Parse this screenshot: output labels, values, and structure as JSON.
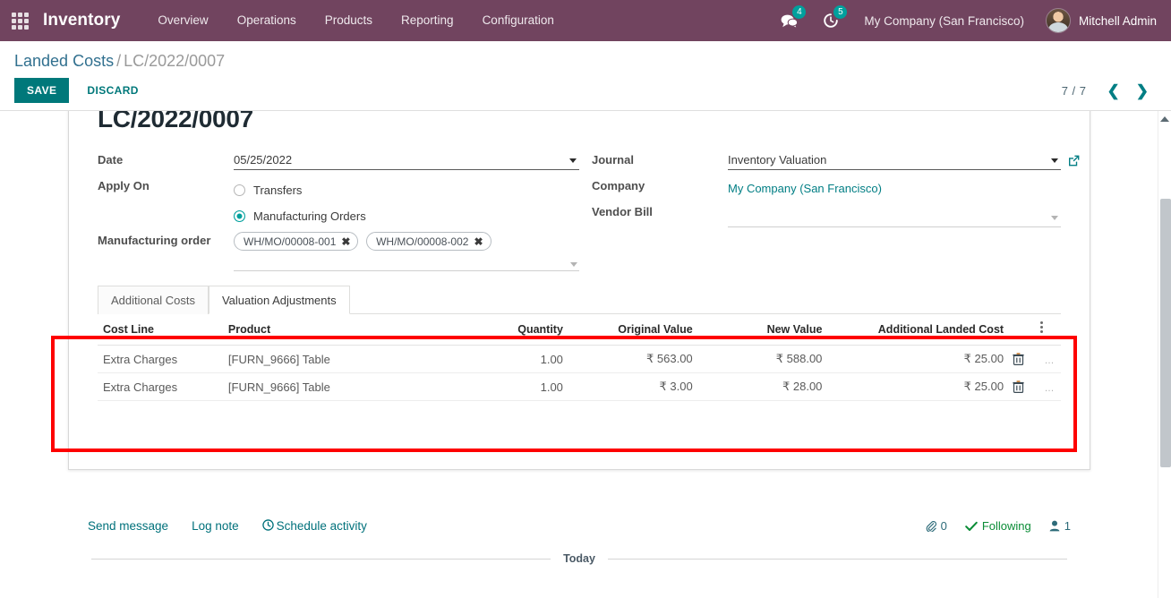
{
  "navbar": {
    "apps_icon": "apps-grid-icon",
    "brand": "Inventory",
    "menus": [
      "Overview",
      "Operations",
      "Products",
      "Reporting",
      "Configuration"
    ],
    "messages_icon": "messages-icon",
    "messages_count": "4",
    "activities_icon": "activities-clock-icon",
    "activities_count": "5",
    "company": "My Company (San Francisco)",
    "user": "Mitchell Admin"
  },
  "control_panel": {
    "breadcrumb_root": "Landed Costs",
    "breadcrumb_sep": "/",
    "breadcrumb_current": "LC/2022/0007",
    "save_label": "SAVE",
    "discard_label": "DISCARD",
    "pager_count": "7 / 7",
    "prev_icon": "chevron-left-icon",
    "next_icon": "chevron-right-icon"
  },
  "form": {
    "record_title": "LC/2022/0007",
    "date_label": "Date",
    "date_value": "05/25/2022",
    "apply_on_label": "Apply On",
    "apply_on_options": [
      {
        "label": "Transfers",
        "selected": false
      },
      {
        "label": "Manufacturing Orders",
        "selected": true
      }
    ],
    "mo_label": "Manufacturing order",
    "mo_tags": [
      "WH/MO/00008-001",
      "WH/MO/00008-002"
    ],
    "journal_label": "Journal",
    "journal_value": "Inventory Valuation",
    "journal_external_icon": "external-link-icon",
    "company_label": "Company",
    "company_value": "My Company (San Francisco)",
    "vendor_bill_label": "Vendor Bill",
    "vendor_bill_value": "",
    "vendor_bill_placeholder": ""
  },
  "notebook": {
    "tabs": [
      {
        "label": "Additional Costs",
        "active": false
      },
      {
        "label": "Valuation Adjustments",
        "active": true
      }
    ]
  },
  "table": {
    "columns": [
      "Cost Line",
      "Product",
      "Quantity",
      "Original Value",
      "New Value",
      "Additional Landed Cost"
    ],
    "optional_columns_icon": "vertical-dots-icon",
    "rows": [
      {
        "cost_line": "Extra Charges",
        "product": "[FURN_9666] Table",
        "quantity": "1.00",
        "original_value": "₹ 563.00",
        "new_value": "₹ 588.00",
        "additional_landed_cost": "₹ 25.00",
        "delete_icon": "trash-icon",
        "overflow": "…"
      },
      {
        "cost_line": "Extra Charges",
        "product": "[FURN_9666] Table",
        "quantity": "1.00",
        "original_value": "₹ 3.00",
        "new_value": "₹ 28.00",
        "additional_landed_cost": "₹ 25.00",
        "delete_icon": "trash-icon",
        "overflow": "…"
      }
    ]
  },
  "annotation": {
    "color": "#fe0000"
  },
  "chatter": {
    "send_message": "Send message",
    "log_note": "Log note",
    "schedule_activity": "Schedule activity",
    "schedule_icon": "clock-icon",
    "attachment_icon": "paperclip-icon",
    "attachment_count": "0",
    "following_icon": "check-icon",
    "following_label": "Following",
    "followers_icon": "user-icon",
    "followers_count": "1",
    "date_separator": "Today"
  },
  "scrollbar": {
    "up_icon": "scroll-up-arrow-icon"
  }
}
